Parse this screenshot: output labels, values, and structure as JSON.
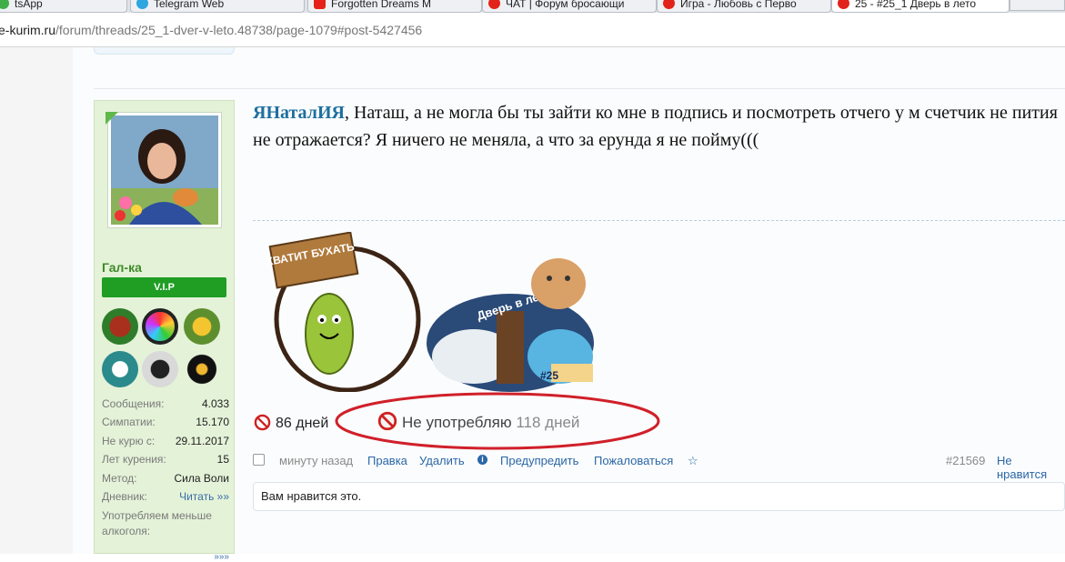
{
  "browser": {
    "tabs": [
      {
        "label": "tsApp",
        "icon": "whatsapp-icon",
        "color": "#3fae48"
      },
      {
        "label": "Telegram Web",
        "icon": "telegram-icon",
        "color": "#2ca5e0"
      },
      {
        "label": "Forgotten Dreams  M",
        "icon": "youtube-icon",
        "color": "#e62117"
      },
      {
        "label": "ЧАТ | Форум бросающи",
        "icon": "forum-icon",
        "color": "#e2231a"
      },
      {
        "label": "Игра - Любовь с Перво",
        "icon": "forum-icon",
        "color": "#e2231a"
      },
      {
        "label": "25 - #25_1 Дверь в лето",
        "icon": "forum-icon",
        "color": "#e2231a"
      }
    ],
    "url_domain": "e-kurim.ru",
    "url_path": "/forum/threads/25_1-dver-v-leto.48738/page-1079#post-5427456"
  },
  "user": {
    "name": "Гал-ка",
    "title": "V.I.P",
    "badges": [
      "no-smoking-badge-icon",
      "rainbow-flower-badge-icon",
      "star-badge-icon",
      "no-drinking-badge-icon",
      "detective-badge-icon",
      "black-flower-badge-icon"
    ],
    "stats": [
      {
        "label": "Сообщения:",
        "value": "4.033"
      },
      {
        "label": "Симпатии:",
        "value": "15.170"
      },
      {
        "label": "Не курю с:",
        "value": "29.11.2017"
      },
      {
        "label": "Лет курения:",
        "value": "15"
      },
      {
        "label": "Метод:",
        "value": "Сила Воли"
      }
    ],
    "diary_label": "Дневник:",
    "diary_link": "Читать »»",
    "extra_label": "Употребляем меньше алкоголя:",
    "more_link": "»»»"
  },
  "post": {
    "mention": "ЯНаталИЯ",
    "text": ", Наташ, а не могла бы ты зайти ко мне в подпись и посмотреть отчего у м счетчик не пития не отражается? Я ничего не меняла, а что за ерунда я не пойму(((",
    "signature": {
      "image1_text": "ХВАТИТ БУХАТЬ",
      "image2_text": "Дверь в лето",
      "image2_badge": "#25"
    },
    "counter1": {
      "value": "86 дней"
    },
    "counter2": {
      "label": "Не употребляю",
      "value": "118 дней"
    },
    "footer": {
      "time": "минуту назад",
      "links": [
        "Правка",
        "Удалить",
        "Предупредить",
        "Пожаловаться"
      ],
      "star": "☆",
      "post_number": "#21569",
      "dislike": "Не нравится"
    },
    "likes_text": "Вам нравится это."
  },
  "colors": {
    "accent_green": "#1f9e23",
    "link_blue": "#2b67a6",
    "annotation_red": "#d0202a"
  }
}
